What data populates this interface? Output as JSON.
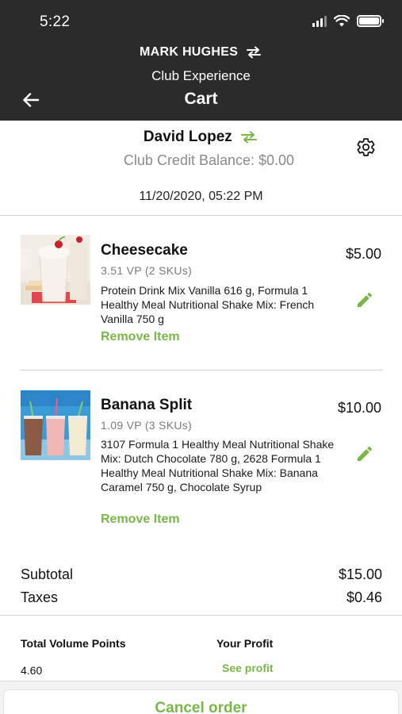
{
  "status_bar": {
    "time": "5:22",
    "icons": [
      "signal-icon",
      "wifi-icon",
      "battery-icon"
    ]
  },
  "header": {
    "distributor_name": "MARK HUGHES",
    "subtitle": "Club Experience",
    "title": "Cart",
    "icons": [
      "back-arrow-icon",
      "swap-icon"
    ]
  },
  "customer": {
    "name": "David Lopez",
    "credit_balance": "Club Credit Balance: $0.00",
    "datetime": "11/20/2020, 05:22 PM",
    "icons": [
      "swap-icon",
      "gear-icon"
    ]
  },
  "items": [
    {
      "name": "Cheesecake",
      "vp": "3.51 VP (2 SKUs)",
      "description": " Protein Drink Mix Vanilla 616 g,  Formula 1 Healthy Meal Nutritional Shake Mix: French Vanilla 750 g",
      "remove_label": "Remove Item",
      "price": "$5.00",
      "image": "cheesecake-shake-photo"
    },
    {
      "name": "Banana Split",
      "vp": "1.09 VP (3 SKUs)",
      "description": " 3107 Formula 1 Healthy Meal Nutritional Shake Mix: Dutch Chocolate 780 g,  2628 Formula 1 Healthy Meal Nutritional Shake Mix: Banana Caramel 750 g,  Chocolate Syrup",
      "remove_label": "Remove Item",
      "price": "$10.00",
      "image": "banana-split-shakes-photo"
    }
  ],
  "totals": {
    "subtotal_label": "Subtotal",
    "subtotal_value": "$15.00",
    "taxes_label": "Taxes",
    "taxes_value": "$0.46"
  },
  "summary": {
    "volume_label": "Total Volume Points",
    "volume_value": "4.60",
    "profit_label": "Your Profit",
    "profit_link": "See profit"
  },
  "footer": {
    "cancel_label": "Cancel order"
  },
  "colors": {
    "header_bg": "#2b2b2b",
    "accent_green": "#7ab648",
    "muted_text": "#8a8a8a"
  }
}
